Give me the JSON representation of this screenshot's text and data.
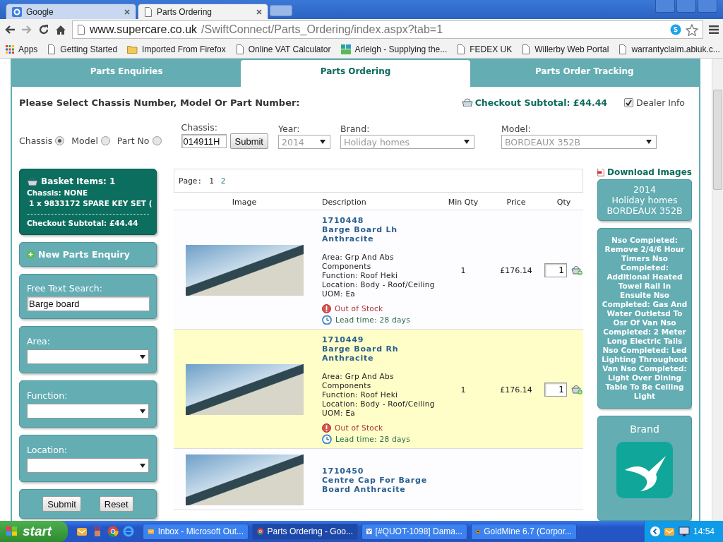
{
  "browser": {
    "tabs": [
      {
        "title": "Google",
        "kind": "google",
        "selected": false
      },
      {
        "title": "Parts Ordering",
        "kind": "page",
        "selected": true
      }
    ],
    "url_host": "www.supercare.co.uk",
    "url_path": "/SwiftConnect/Parts_Ordering/index.aspx?tab=1",
    "bookmarks": [
      {
        "label": "Apps",
        "kind": "apps"
      },
      {
        "label": "Getting Started",
        "kind": "page"
      },
      {
        "label": "Imported From Firefox",
        "kind": "folder"
      },
      {
        "label": "Online VAT Calculator",
        "kind": "page"
      },
      {
        "label": "Arleigh - Supplying the...",
        "kind": "site"
      },
      {
        "label": "FEDEX UK",
        "kind": "page"
      },
      {
        "label": "Willerby Web Portal",
        "kind": "page"
      },
      {
        "label": "warrantyclaim.abiuk.c...",
        "kind": "page"
      }
    ]
  },
  "nav_tabs": [
    {
      "label": "Parts Enquiries",
      "selected": false
    },
    {
      "label": "Parts Ordering",
      "selected": true
    },
    {
      "label": "Parts Order Tracking",
      "selected": false
    }
  ],
  "heading": "Please Select Chassis Number, Model Or Part Number:",
  "checkout_subtotal": "Checkout Subtotal: £44.44",
  "dealer_info": {
    "label": "Dealer Info",
    "checked": true
  },
  "search_mode": [
    {
      "label": "Chassis",
      "selected": true
    },
    {
      "label": "Model",
      "selected": false
    },
    {
      "label": "Part No",
      "selected": false
    }
  ],
  "chassis": {
    "label": "Chassis:",
    "value": "014911H",
    "button": "Submit"
  },
  "year": {
    "label": "Year:",
    "value": "2014"
  },
  "brand": {
    "label": "Brand:",
    "value": "Holiday homes"
  },
  "model": {
    "label": "Model:",
    "value": "BORDEAUX 352B"
  },
  "basket": {
    "title": "Basket Items: 1",
    "chassis": "Chassis: NONE",
    "items": [
      "1 x 9833172 SPARE KEY SET ("
    ],
    "subtotal": "Checkout Subtotal: £44.44"
  },
  "new_enquiry": "New Parts Enquiry",
  "free_text": {
    "label": "Free Text Search:",
    "value": "Barge board"
  },
  "filters": [
    {
      "label": "Area:"
    },
    {
      "label": "Function:"
    },
    {
      "label": "Location:"
    }
  ],
  "filter_buttons": [
    "Submit",
    "Reset"
  ],
  "pager": {
    "label": "Page:",
    "pages": [
      {
        "label": "1",
        "selected": true
      },
      {
        "label": "2",
        "selected": false
      }
    ]
  },
  "table": {
    "columns": [
      "Image",
      "Description",
      "Min Qty",
      "Price",
      "Qty"
    ],
    "rows": [
      {
        "code": "1710448",
        "name": "Barge Board Lh Anthracite",
        "details": [
          "Area: Grp And Abs Components",
          "Function: Roof Heki",
          "Location: Body - Roof/Ceiling",
          "UOM: Ea"
        ],
        "stock": "Out of Stock",
        "lead": "Lead time: 28 days",
        "min_qty": "1",
        "price": "£176.14",
        "qty": "1",
        "highlighted": false
      },
      {
        "code": "1710449",
        "name": "Barge Board Rh Anthracite",
        "details": [
          "Area: Grp And Abs Components",
          "Function: Roof Heki",
          "Location: Body - Roof/Ceiling",
          "UOM: Ea"
        ],
        "stock": "Out of Stock",
        "lead": "Lead time: 28 days",
        "min_qty": "1",
        "price": "£176.14",
        "qty": "1",
        "highlighted": true
      },
      {
        "code": "1710450",
        "name": "Centre Cap For Barge Board Anthracite",
        "details": [],
        "highlighted": false
      }
    ]
  },
  "download_images": "Download Images",
  "model_box": [
    "2014",
    "Holiday homes",
    "BORDEAUX 352B"
  ],
  "notes": "Nso Completed: Remove 2/4/6 Hour Timers Nso Completed: Additional Heated Towel Rail In Ensuite Nso Completed: Gas And Water Outletsd To Osr Of Van Nso Completed: 2 Meter Long Electric Tails Nso Completed: Led Lighting Throughout Van Nso Completed: Light Over Dining Table To Be Ceiling Light",
  "brand_panel": "Brand",
  "taskbar": {
    "start": "start",
    "tasks": [
      {
        "title": "Inbox - Microsoft Out...",
        "kind": "mail",
        "selected": false
      },
      {
        "title": "Parts Ordering - Goo...",
        "kind": "browser",
        "selected": true
      },
      {
        "title": "[#QUOT-1098] Dama...",
        "kind": "ticket",
        "selected": false
      },
      {
        "title": "GoldMine 6.7 (Corpor...",
        "kind": "app",
        "selected": false
      }
    ],
    "clock": "14:54"
  }
}
